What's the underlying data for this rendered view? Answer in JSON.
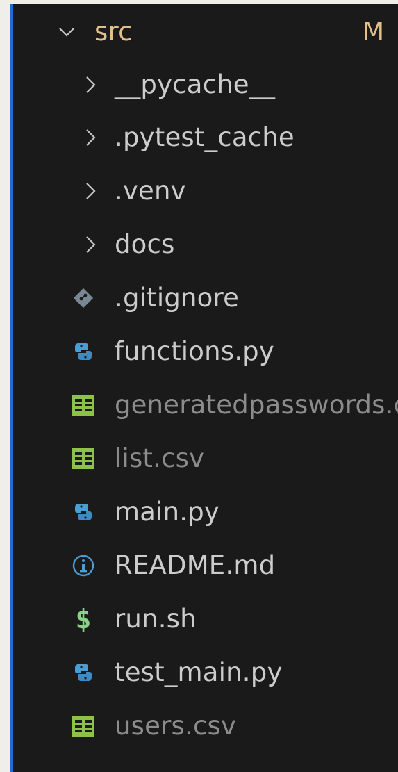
{
  "explorer": {
    "root": {
      "label": "src",
      "badge": "M",
      "state": "expanded"
    },
    "folders": [
      {
        "label": "__pycache__"
      },
      {
        "label": ".pytest_cache"
      },
      {
        "label": ".venv"
      },
      {
        "label": "docs"
      }
    ],
    "files": [
      {
        "label": ".gitignore",
        "icon": "git-icon"
      },
      {
        "label": "functions.py",
        "icon": "python-icon"
      },
      {
        "label": "generatedpasswords.csv",
        "icon": "csv-table-icon",
        "dimmed": true
      },
      {
        "label": "list.csv",
        "icon": "csv-table-icon",
        "dimmed": true
      },
      {
        "label": "main.py",
        "icon": "python-icon"
      },
      {
        "label": "README.md",
        "icon": "info-icon"
      },
      {
        "label": "run.sh",
        "icon": "shell-dollar-icon",
        "glyph": "$"
      },
      {
        "label": "test_main.py",
        "icon": "python-icon"
      },
      {
        "label": "users.csv",
        "icon": "csv-table-icon",
        "dimmed": true
      }
    ]
  },
  "colors": {
    "panel_bg": "#1a1a1a",
    "text": "#cccccc",
    "dimmed_text": "#8c8c8c",
    "modified": "#e2c08d",
    "indent_guide": "#1f6bd1",
    "python": "#4a9ed4",
    "csv": "#8dc149",
    "shell": "#89d185",
    "git": "#7a8794"
  }
}
